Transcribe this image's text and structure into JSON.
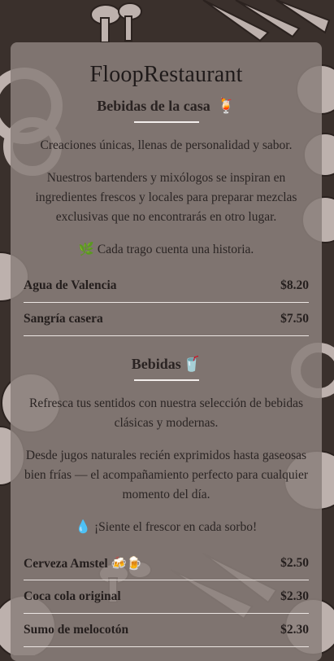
{
  "restaurant_name": "FloopRestaurant",
  "sections": [
    {
      "title": "Bebidas de la casa",
      "title_emoji": "🍹",
      "paragraphs": [
        "Creaciones únicas, llenas de personalidad y sabor.",
        "Nuestros bartenders y mixólogos se inspiran en ingredientes frescos y locales para preparar mezclas exclusivas que no encontrarás en otro lugar.",
        "🌿 Cada trago cuenta una historia."
      ],
      "items": [
        {
          "name": "Agua de Valencia",
          "price": "$8.20"
        },
        {
          "name": "Sangría casera",
          "price": "$7.50"
        }
      ]
    },
    {
      "title": "Bebidas",
      "title_emoji": "🥤",
      "paragraphs": [
        "Refresca tus sentidos con nuestra selección de bebidas clásicas y modernas.",
        "Desde jugos naturales recién exprimidos hasta gaseosas bien frías — el acompañamiento perfecto para cualquier momento del día.",
        "💧 ¡Siente el frescor en cada sorbo!"
      ],
      "items": [
        {
          "name": "Cerveza Amstel",
          "emoji": "🍻🍺",
          "price": "$2.50"
        },
        {
          "name": "Coca cola original",
          "price": "$2.30"
        },
        {
          "name": "Sumo de melocotón",
          "price": "$2.30"
        }
      ]
    }
  ],
  "colors": {
    "background": "#3a302c",
    "card": "#8a807c",
    "divider": "#ece6e3",
    "text": "#2b2524"
  }
}
